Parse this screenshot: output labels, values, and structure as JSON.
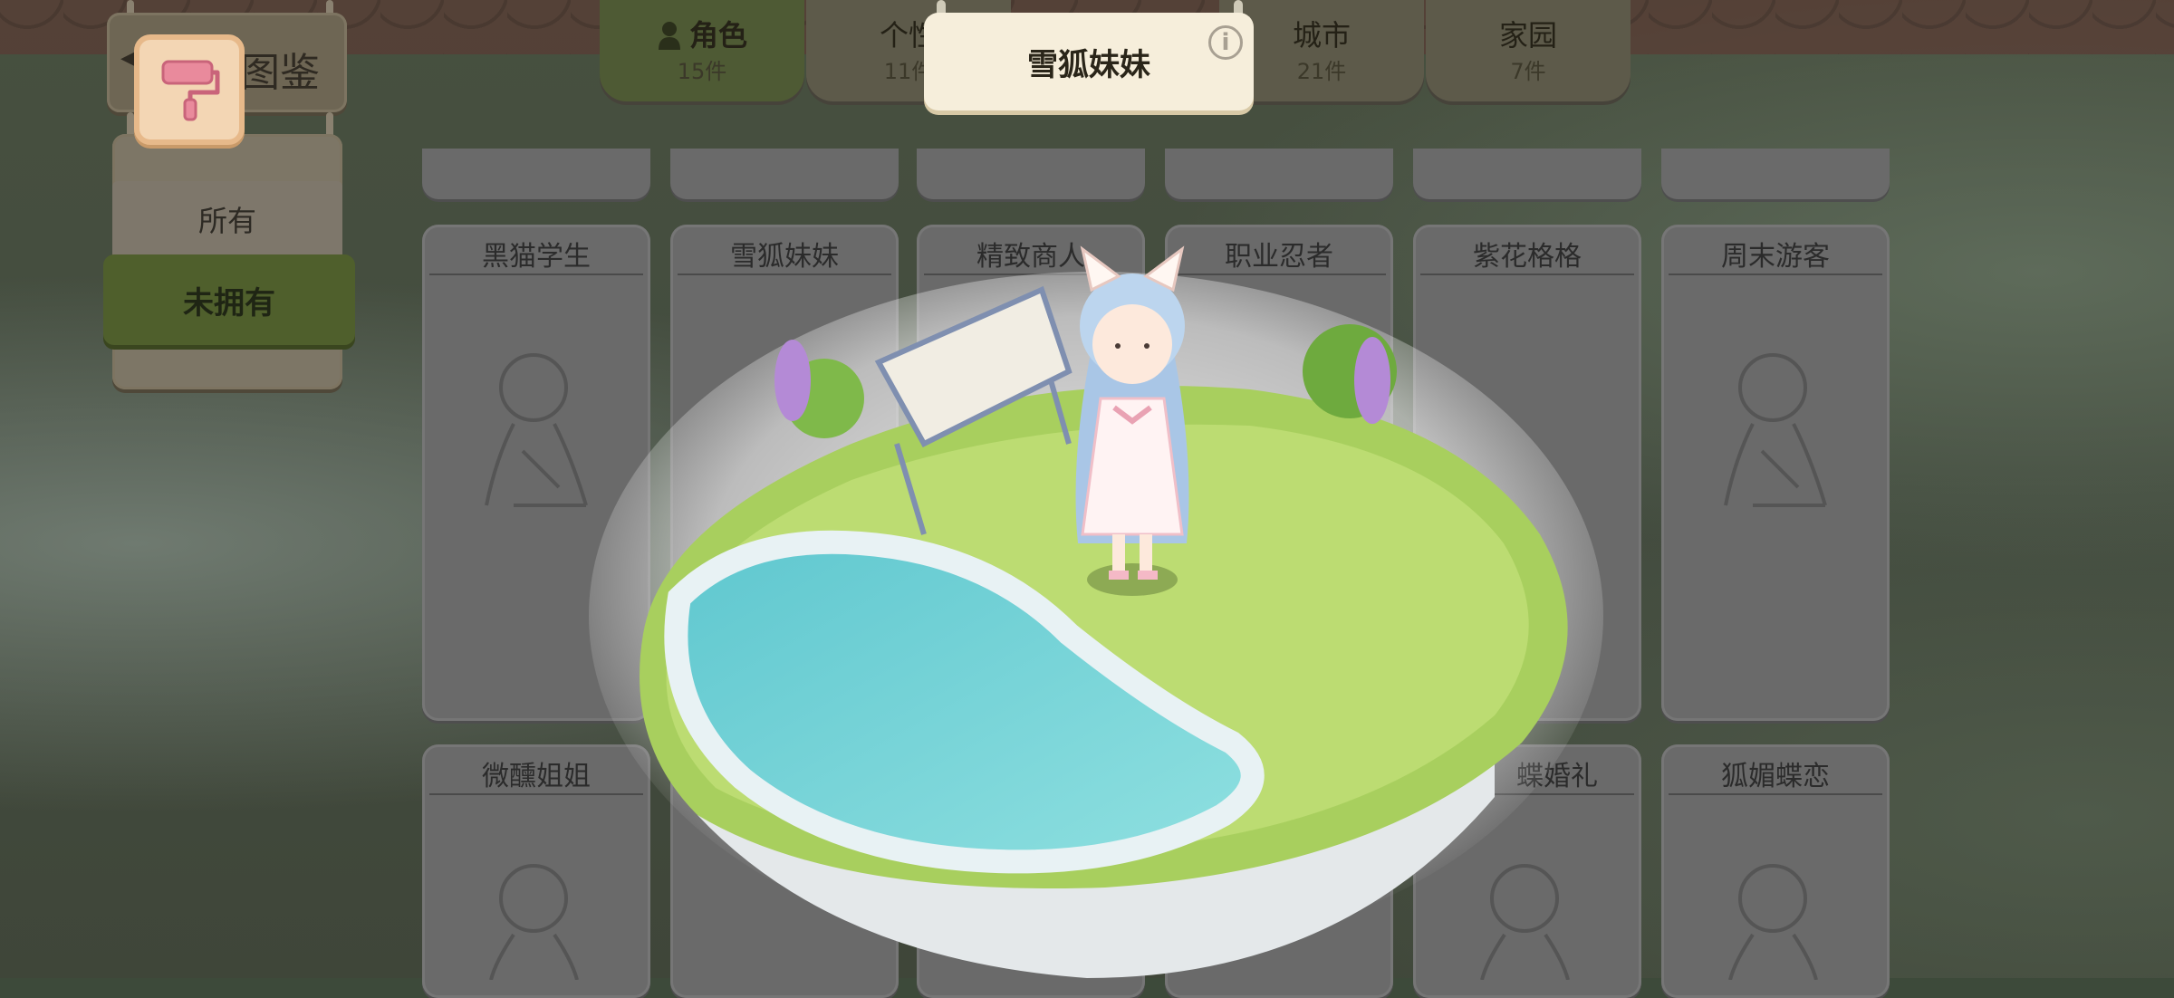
{
  "header": {
    "title": "图鉴",
    "back_arrow": "◀"
  },
  "filters": {
    "all": "所有",
    "unowned": "未拥有"
  },
  "tabs": [
    {
      "label": "角色",
      "count": "15件",
      "active": true
    },
    {
      "label": "个性",
      "count": "11件",
      "active": false
    },
    {
      "label": "城市",
      "count": "21件",
      "active": false
    },
    {
      "label": "家园",
      "count": "7件",
      "active": false
    }
  ],
  "detail": {
    "title": "雪狐妹妹",
    "info_symbol": "i"
  },
  "cards_row1": [
    "黑猫学生",
    "雪狐妹妹",
    "精致商人",
    "职业忍者",
    "紫花格格",
    "周末游客"
  ],
  "cards_row2": [
    "微醺姐姐",
    "蝶婚礼",
    "狐媚蝶恋"
  ],
  "icons": {
    "back": "back-arrow-icon",
    "paint": "paint-roller-icon",
    "role": "person-icon",
    "info": "info-icon",
    "silhouette": "character-silhouette-icon"
  },
  "colors": {
    "active_tab": "#4e5a34",
    "filter_active": "#4f5f2c",
    "card": "#6a6a6a",
    "pond": "#7fd6d6",
    "grass": "#a8cf5e"
  }
}
